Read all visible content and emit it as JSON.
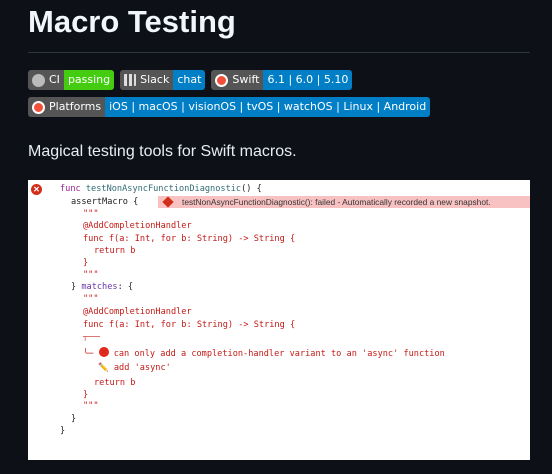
{
  "title": "Macro Testing",
  "badges_row1": [
    {
      "icon": "github-icon",
      "label": "CI",
      "value": "passing",
      "color": "#4c1"
    },
    {
      "icon": "slack-icon",
      "label": "Slack",
      "value": "chat",
      "color": "#007ec6"
    },
    {
      "icon": "swift-icon",
      "label": "Swift",
      "value": "6.1 | 6.0 | 5.10",
      "color": "#007ec6"
    }
  ],
  "badges_row2": [
    {
      "icon": "swift-icon",
      "label": "Platforms",
      "value": "iOS | macOS | visionOS | tvOS | watchOS | Linux | Android",
      "color": "#007ec6"
    }
  ],
  "description": "Magical testing tools for Swift macros.",
  "screenshot": {
    "banner": "testNonAsyncFunctionDiagnostic(): failed - Automatically recorded a new snapshot.",
    "lines": {
      "l1a": "func ",
      "l1b": "testNonAsyncFunctionDiagnostic",
      "l1c": "() {",
      "l2": "assertMacro {",
      "l3": "\"\"\"",
      "l4": "@AddCompletionHandler",
      "l5": "func f(a: Int, for b: String) -> String {",
      "l6": "return b",
      "l7": "}",
      "l8": "\"\"\"",
      "l9a": "} ",
      "l9b": "matches",
      "l9c": ": {",
      "l10": "\"\"\"",
      "l11": "@AddCompletionHandler",
      "l12": "func f(a: Int, for b: String) -> String {",
      "l13": "┬───",
      "l14a": "╰─ ",
      "l14b": " can only add a completion-handler variant to an 'async' function",
      "l15a": "✏️",
      "l15b": " add 'async'",
      "l16": "return b",
      "l17": "}",
      "l18": "\"\"\"",
      "l19": "}",
      "l20": "}"
    }
  }
}
